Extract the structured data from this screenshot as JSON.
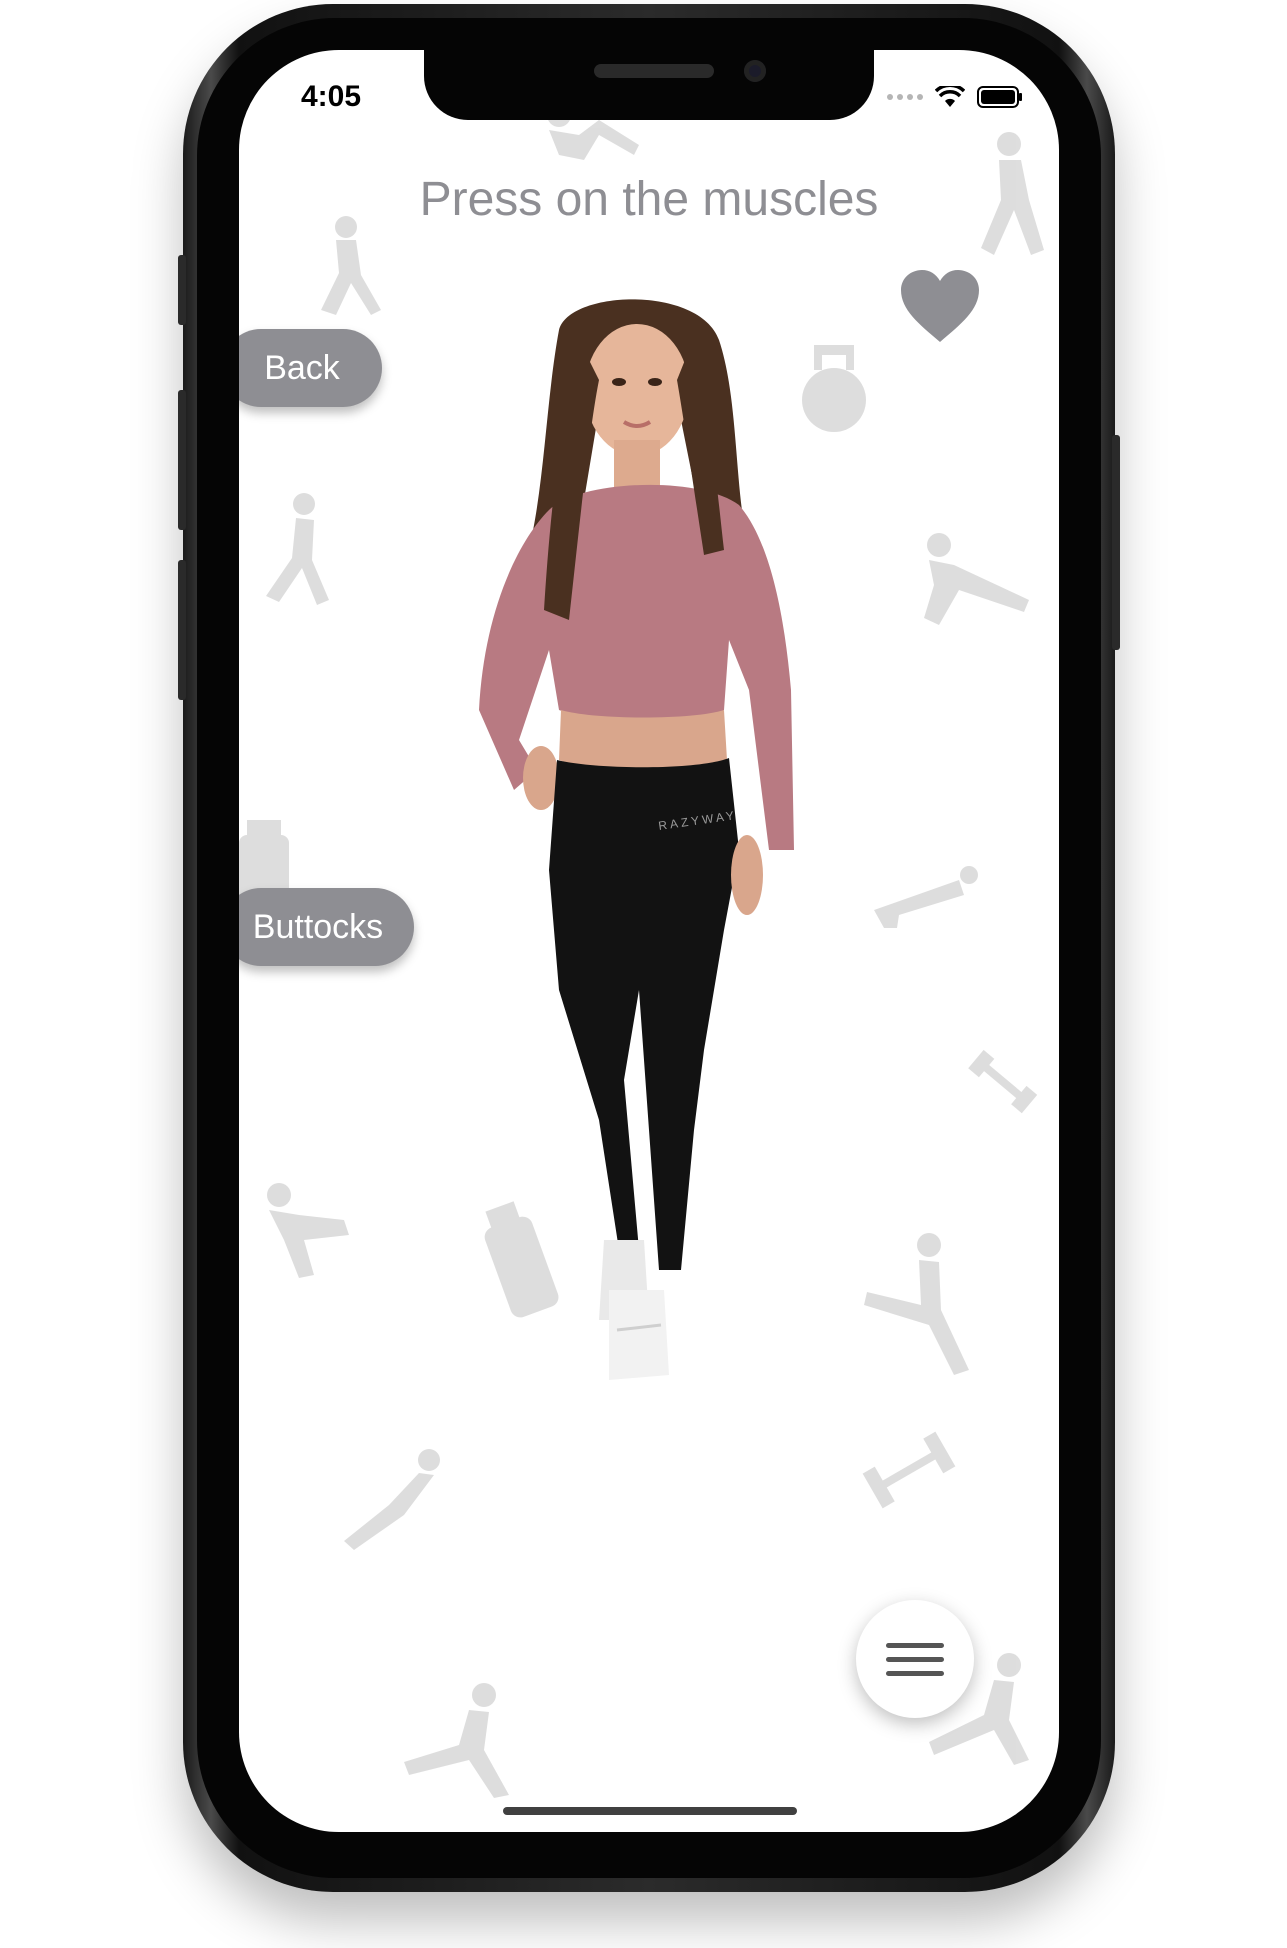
{
  "status_bar": {
    "time": "4:05",
    "wifi_icon": "wifi-icon",
    "battery_icon": "battery-icon"
  },
  "header": {
    "instruction": "Press on the muscles"
  },
  "buttons": {
    "back_label": "Back",
    "muscle_label": "Buttocks",
    "favorite_icon": "heart-icon",
    "menu_icon": "hamburger-menu-icon"
  },
  "colors": {
    "pill_bg": "#8e8e93",
    "title_text": "#8e8e93",
    "heart": "#8e8e93",
    "top": "#b87a82",
    "leggings": "#121212"
  },
  "figure": {
    "description_icon": "fitness-model-figure",
    "shirt_brand": "RAZYWAY",
    "leggings_brand": "RAZYWAY"
  }
}
